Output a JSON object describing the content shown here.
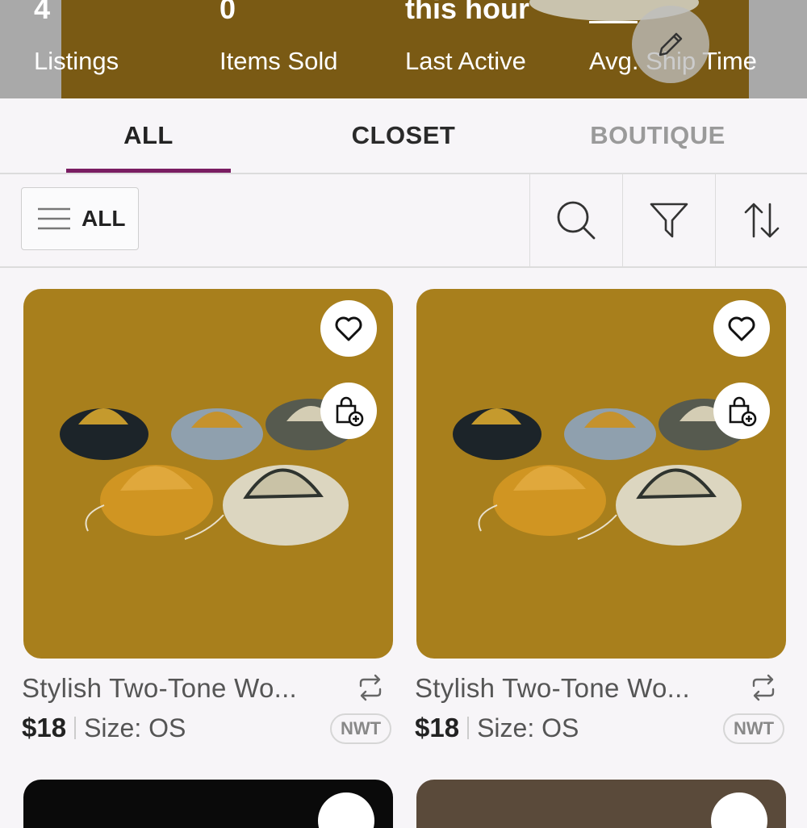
{
  "stats": [
    {
      "value": "4",
      "label": "Listings"
    },
    {
      "value": "0",
      "label": "Items Sold"
    },
    {
      "value": "this hour",
      "label": "Last Active"
    },
    {
      "value": "",
      "label": "Avg. Ship Time"
    }
  ],
  "tabs": [
    {
      "label": "ALL",
      "active": true
    },
    {
      "label": "CLOSET",
      "active": false
    },
    {
      "label": "BOUTIQUE",
      "active": false
    }
  ],
  "toolbar": {
    "filter_label": "ALL",
    "icons": [
      "menu-lines-icon",
      "search-icon",
      "filter-funnel-icon",
      "sort-arrows-icon"
    ]
  },
  "products": [
    {
      "title": "Stylish Two-Tone Wo...",
      "price": "$18",
      "size": "Size: OS",
      "badge": "NWT"
    },
    {
      "title": "Stylish Two-Tone Wo...",
      "price": "$18",
      "size": "Size: OS",
      "badge": "NWT"
    }
  ],
  "colors": {
    "accent": "#7a1d62",
    "product_bg": "#a87f1c",
    "header_bg": "#7a5a14"
  }
}
